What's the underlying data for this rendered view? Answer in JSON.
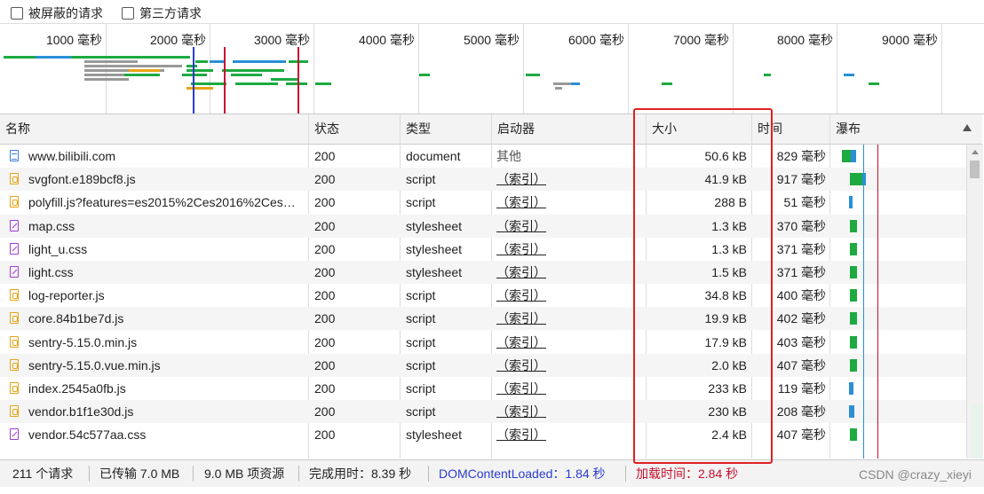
{
  "toolbar": {
    "blocked_requests": "被屏蔽的请求",
    "third_party_requests": "第三方请求"
  },
  "overview": {
    "ticks": [
      "1000 毫秒",
      "2000 毫秒",
      "3000 毫秒",
      "4000 毫秒",
      "5000 毫秒",
      "6000 毫秒",
      "7000 毫秒",
      "8000 毫秒",
      "9000 毫秒"
    ],
    "colors": {
      "dom_content_loaded": "#2a3ccf",
      "load": "#c8102e",
      "green": "#1eaa41",
      "blue": "#2a8fd6",
      "gray": "#999999"
    }
  },
  "columns": {
    "name": "名称",
    "status": "状态",
    "type": "类型",
    "initiator": "启动器",
    "size": "大小",
    "time": "时间",
    "waterfall": "瀑布"
  },
  "rows": [
    {
      "name": "www.bilibili.com",
      "status": "200",
      "type": "document",
      "initiator": "其他",
      "size": "50.6 kB",
      "time": "829 毫秒",
      "icon": "document-icon"
    },
    {
      "name": "svgfont.e189bcf8.js",
      "status": "200",
      "type": "script",
      "initiator": "（索引）",
      "size": "41.9 kB",
      "time": "917 毫秒",
      "icon": "script-icon"
    },
    {
      "name": "polyfill.js?features=es2015%2Ces2016%2Ces…",
      "status": "200",
      "type": "script",
      "initiator": "（索引）",
      "size": "288 B",
      "time": "51 毫秒",
      "icon": "script-icon"
    },
    {
      "name": "map.css",
      "status": "200",
      "type": "stylesheet",
      "initiator": "（索引）",
      "size": "1.3 kB",
      "time": "370 毫秒",
      "icon": "stylesheet-icon"
    },
    {
      "name": "light_u.css",
      "status": "200",
      "type": "stylesheet",
      "initiator": "（索引）",
      "size": "1.3 kB",
      "time": "371 毫秒",
      "icon": "stylesheet-icon"
    },
    {
      "name": "light.css",
      "status": "200",
      "type": "stylesheet",
      "initiator": "（索引）",
      "size": "1.5 kB",
      "time": "371 毫秒",
      "icon": "stylesheet-icon"
    },
    {
      "name": "log-reporter.js",
      "status": "200",
      "type": "script",
      "initiator": "（索引）",
      "size": "34.8 kB",
      "time": "400 毫秒",
      "icon": "script-icon"
    },
    {
      "name": "core.84b1be7d.js",
      "status": "200",
      "type": "script",
      "initiator": "（索引）",
      "size": "19.9 kB",
      "time": "402 毫秒",
      "icon": "script-icon"
    },
    {
      "name": "sentry-5.15.0.min.js",
      "status": "200",
      "type": "script",
      "initiator": "（索引）",
      "size": "17.9 kB",
      "time": "403 毫秒",
      "icon": "script-icon"
    },
    {
      "name": "sentry-5.15.0.vue.min.js",
      "status": "200",
      "type": "script",
      "initiator": "（索引）",
      "size": "2.0 kB",
      "time": "407 毫秒",
      "icon": "script-icon"
    },
    {
      "name": "index.2545a0fb.js",
      "status": "200",
      "type": "script",
      "initiator": "（索引）",
      "size": "233 kB",
      "time": "119 毫秒",
      "icon": "script-icon"
    },
    {
      "name": "vendor.b1f1e30d.js",
      "status": "200",
      "type": "script",
      "initiator": "（索引）",
      "size": "230 kB",
      "time": "208 毫秒",
      "icon": "script-icon"
    },
    {
      "name": "vendor.54c577aa.css",
      "status": "200",
      "type": "stylesheet",
      "initiator": "（索引）",
      "size": "2.4 kB",
      "time": "407 毫秒",
      "icon": "stylesheet-icon"
    }
  ],
  "status_bar": {
    "requests": "211 个请求",
    "transferred": "已传输 7.0 MB",
    "resources": "9.0 MB 项资源",
    "finish": "完成用时：8.39 秒",
    "dom_content_loaded": "DOMContentLoaded：1.84 秒",
    "load": "加载时间：2.84 秒"
  },
  "watermark": "CSDN @crazy_xieyi"
}
